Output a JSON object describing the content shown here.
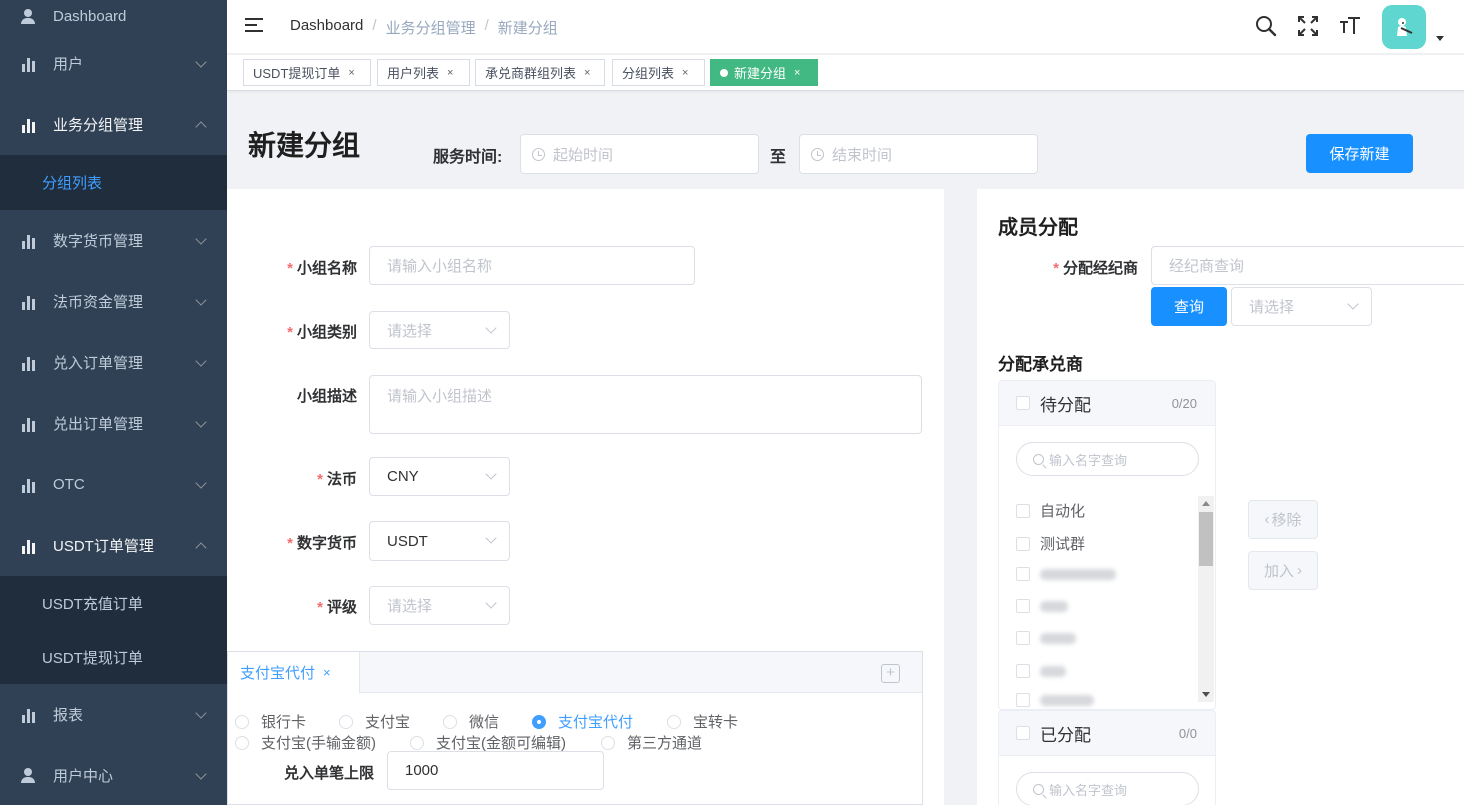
{
  "sidebar": {
    "items": [
      {
        "label": "Dashboard",
        "icon": "user-icon"
      },
      {
        "label": "用户",
        "icon": "bar-chart-icon"
      },
      {
        "label": "业务分组管理",
        "icon": "bar-chart-icon"
      },
      {
        "label": "数字货币管理",
        "icon": "bar-chart-icon"
      },
      {
        "label": "法币资金管理",
        "icon": "bar-chart-icon"
      },
      {
        "label": "兑入订单管理",
        "icon": "bar-chart-icon"
      },
      {
        "label": "兑出订单管理",
        "icon": "bar-chart-icon"
      },
      {
        "label": "OTC",
        "icon": "bar-chart-icon"
      },
      {
        "label": "USDT订单管理",
        "icon": "bar-chart-icon"
      },
      {
        "label": "报表",
        "icon": "bar-chart-icon"
      },
      {
        "label": "用户中心",
        "icon": "user-icon"
      }
    ],
    "group_sub": [
      "分组列表"
    ],
    "usdt_sub": [
      "USDT充值订单",
      "USDT提现订单"
    ]
  },
  "breadcrumb": [
    "Dashboard",
    "业务分组管理",
    "新建分组"
  ],
  "tags": [
    {
      "label": "USDT提现订单"
    },
    {
      "label": "用户列表"
    },
    {
      "label": "承兑商群组列表"
    },
    {
      "label": "分组列表"
    },
    {
      "label": "新建分组"
    }
  ],
  "page": {
    "title": "新建分组",
    "time_label": "服务时间:",
    "start_placeholder": "起始时间",
    "to_label": "至",
    "end_placeholder": "结束时间",
    "save_label": "保存新建"
  },
  "form": {
    "name_label": "小组名称",
    "name_placeholder": "请输入小组名称",
    "category_label": "小组类别",
    "category_placeholder": "请选择",
    "desc_label": "小组描述",
    "desc_placeholder": "请输入小组描述",
    "fiat_label": "法币",
    "fiat_value": "CNY",
    "crypto_label": "数字货币",
    "crypto_value": "USDT",
    "rating_label": "评级",
    "rating_placeholder": "请选择"
  },
  "payment": {
    "tab_label": "支付宝代付",
    "add_symbol": "+",
    "options_row1": [
      "银行卡",
      "支付宝",
      "微信",
      "支付宝代付",
      "宝转卡"
    ],
    "options_row2": [
      "支付宝(手输金额)",
      "支付宝(金额可编辑)",
      "第三方通道"
    ],
    "selected": "支付宝代付",
    "limit_label": "兑入单笔上限",
    "limit_value": "1000"
  },
  "members": {
    "title": "成员分配",
    "broker_label": "分配经纪商",
    "broker_placeholder": "经纪商查询",
    "query_label": "查询",
    "select_placeholder": "请选择",
    "acceptor_title": "分配承兑商",
    "pending": {
      "title": "待分配",
      "count": "0/20",
      "search_placeholder": "输入名字查询",
      "items": [
        "自动化",
        "测试群"
      ]
    },
    "assigned": {
      "title": "已分配",
      "count": "0/0",
      "search_placeholder": "输入名字查询"
    },
    "remove_label": "移除",
    "add_label": "加入"
  },
  "colors": {
    "sidebar_bg": "#304156",
    "primary": "#1890ff",
    "active_tag": "#42b983"
  }
}
